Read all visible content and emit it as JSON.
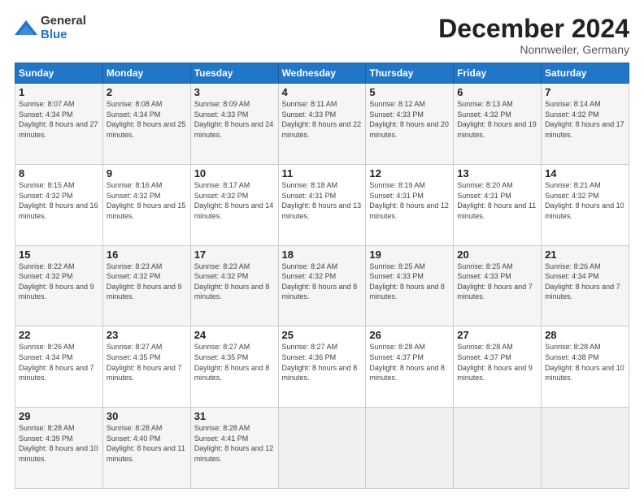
{
  "logo": {
    "general": "General",
    "blue": "Blue"
  },
  "title": "December 2024",
  "location": "Nonnweiler, Germany",
  "days_of_week": [
    "Sunday",
    "Monday",
    "Tuesday",
    "Wednesday",
    "Thursday",
    "Friday",
    "Saturday"
  ],
  "weeks": [
    [
      {
        "day": "1",
        "sunrise": "8:07 AM",
        "sunset": "4:34 PM",
        "daylight": "8 hours and 27 minutes."
      },
      {
        "day": "2",
        "sunrise": "8:08 AM",
        "sunset": "4:34 PM",
        "daylight": "8 hours and 25 minutes."
      },
      {
        "day": "3",
        "sunrise": "8:09 AM",
        "sunset": "4:33 PM",
        "daylight": "8 hours and 24 minutes."
      },
      {
        "day": "4",
        "sunrise": "8:11 AM",
        "sunset": "4:33 PM",
        "daylight": "8 hours and 22 minutes."
      },
      {
        "day": "5",
        "sunrise": "8:12 AM",
        "sunset": "4:33 PM",
        "daylight": "8 hours and 20 minutes."
      },
      {
        "day": "6",
        "sunrise": "8:13 AM",
        "sunset": "4:32 PM",
        "daylight": "8 hours and 19 minutes."
      },
      {
        "day": "7",
        "sunrise": "8:14 AM",
        "sunset": "4:32 PM",
        "daylight": "8 hours and 17 minutes."
      }
    ],
    [
      {
        "day": "8",
        "sunrise": "8:15 AM",
        "sunset": "4:32 PM",
        "daylight": "8 hours and 16 minutes."
      },
      {
        "day": "9",
        "sunrise": "8:16 AM",
        "sunset": "4:32 PM",
        "daylight": "8 hours and 15 minutes."
      },
      {
        "day": "10",
        "sunrise": "8:17 AM",
        "sunset": "4:32 PM",
        "daylight": "8 hours and 14 minutes."
      },
      {
        "day": "11",
        "sunrise": "8:18 AM",
        "sunset": "4:31 PM",
        "daylight": "8 hours and 13 minutes."
      },
      {
        "day": "12",
        "sunrise": "8:19 AM",
        "sunset": "4:31 PM",
        "daylight": "8 hours and 12 minutes."
      },
      {
        "day": "13",
        "sunrise": "8:20 AM",
        "sunset": "4:31 PM",
        "daylight": "8 hours and 11 minutes."
      },
      {
        "day": "14",
        "sunrise": "8:21 AM",
        "sunset": "4:32 PM",
        "daylight": "8 hours and 10 minutes."
      }
    ],
    [
      {
        "day": "15",
        "sunrise": "8:22 AM",
        "sunset": "4:32 PM",
        "daylight": "8 hours and 9 minutes."
      },
      {
        "day": "16",
        "sunrise": "8:23 AM",
        "sunset": "4:32 PM",
        "daylight": "8 hours and 9 minutes."
      },
      {
        "day": "17",
        "sunrise": "8:23 AM",
        "sunset": "4:32 PM",
        "daylight": "8 hours and 8 minutes."
      },
      {
        "day": "18",
        "sunrise": "8:24 AM",
        "sunset": "4:32 PM",
        "daylight": "8 hours and 8 minutes."
      },
      {
        "day": "19",
        "sunrise": "8:25 AM",
        "sunset": "4:33 PM",
        "daylight": "8 hours and 8 minutes."
      },
      {
        "day": "20",
        "sunrise": "8:25 AM",
        "sunset": "4:33 PM",
        "daylight": "8 hours and 7 minutes."
      },
      {
        "day": "21",
        "sunrise": "8:26 AM",
        "sunset": "4:34 PM",
        "daylight": "8 hours and 7 minutes."
      }
    ],
    [
      {
        "day": "22",
        "sunrise": "8:26 AM",
        "sunset": "4:34 PM",
        "daylight": "8 hours and 7 minutes."
      },
      {
        "day": "23",
        "sunrise": "8:27 AM",
        "sunset": "4:35 PM",
        "daylight": "8 hours and 7 minutes."
      },
      {
        "day": "24",
        "sunrise": "8:27 AM",
        "sunset": "4:35 PM",
        "daylight": "8 hours and 8 minutes."
      },
      {
        "day": "25",
        "sunrise": "8:27 AM",
        "sunset": "4:36 PM",
        "daylight": "8 hours and 8 minutes."
      },
      {
        "day": "26",
        "sunrise": "8:28 AM",
        "sunset": "4:37 PM",
        "daylight": "8 hours and 8 minutes."
      },
      {
        "day": "27",
        "sunrise": "8:28 AM",
        "sunset": "4:37 PM",
        "daylight": "8 hours and 9 minutes."
      },
      {
        "day": "28",
        "sunrise": "8:28 AM",
        "sunset": "4:38 PM",
        "daylight": "8 hours and 10 minutes."
      }
    ],
    [
      {
        "day": "29",
        "sunrise": "8:28 AM",
        "sunset": "4:39 PM",
        "daylight": "8 hours and 10 minutes."
      },
      {
        "day": "30",
        "sunrise": "8:28 AM",
        "sunset": "4:40 PM",
        "daylight": "8 hours and 11 minutes."
      },
      {
        "day": "31",
        "sunrise": "8:28 AM",
        "sunset": "4:41 PM",
        "daylight": "8 hours and 12 minutes."
      },
      null,
      null,
      null,
      null
    ]
  ],
  "labels": {
    "sunrise": "Sunrise:",
    "sunset": "Sunset:",
    "daylight": "Daylight:"
  }
}
